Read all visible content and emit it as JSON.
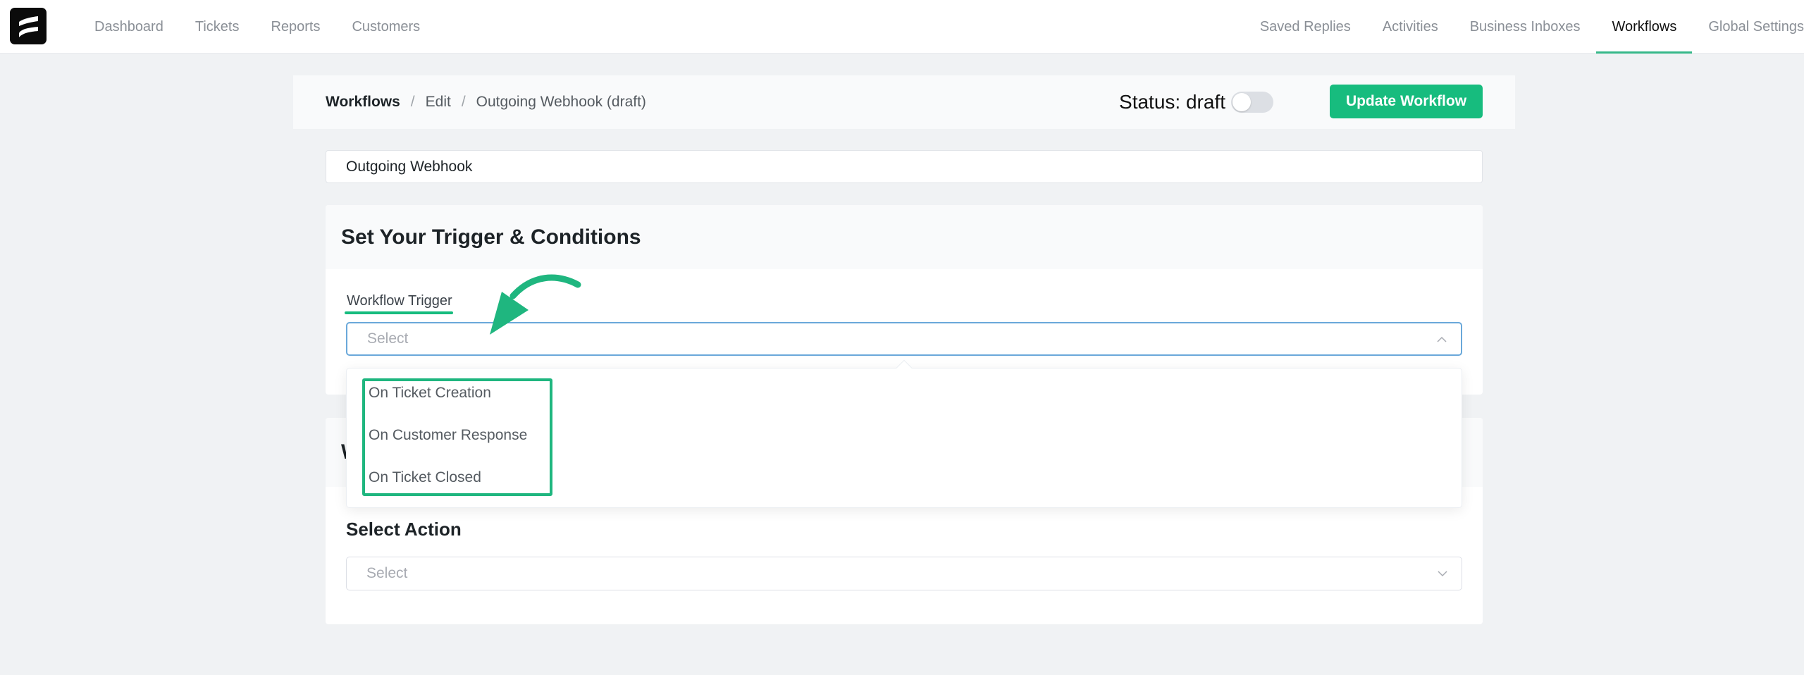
{
  "nav": {
    "logo": "app-logo",
    "left_items": [
      {
        "label": "Dashboard"
      },
      {
        "label": "Tickets"
      },
      {
        "label": "Reports"
      },
      {
        "label": "Customers"
      }
    ],
    "right_items": [
      {
        "label": "Saved Replies"
      },
      {
        "label": "Activities"
      },
      {
        "label": "Business Inboxes"
      },
      {
        "label": "Workflows",
        "active": true
      },
      {
        "label": "Global Settings"
      }
    ]
  },
  "header": {
    "breadcrumb": {
      "root": "Workflows",
      "separator": "/",
      "middle": "Edit",
      "current": "Outgoing Webhook (draft)"
    },
    "status_label": "Status: draft",
    "status_toggle_on": false,
    "update_button": "Update Workflow"
  },
  "workflow_name": {
    "value": "Outgoing Webhook"
  },
  "trigger_section": {
    "title": "Set Your Trigger & Conditions",
    "field_label": "Workflow Trigger",
    "select_placeholder": "Select",
    "dropdown_open": true,
    "options": [
      {
        "label": "On Ticket Creation"
      },
      {
        "label": "On Customer Response"
      },
      {
        "label": "On Ticket Closed"
      }
    ]
  },
  "action_section": {
    "title_partial": "W",
    "action_label": "Select Action",
    "select_placeholder": "Select"
  },
  "colors": {
    "accent": "#17bc7e",
    "focus_border": "#6aa8da",
    "annotation": "#1fb67f"
  }
}
